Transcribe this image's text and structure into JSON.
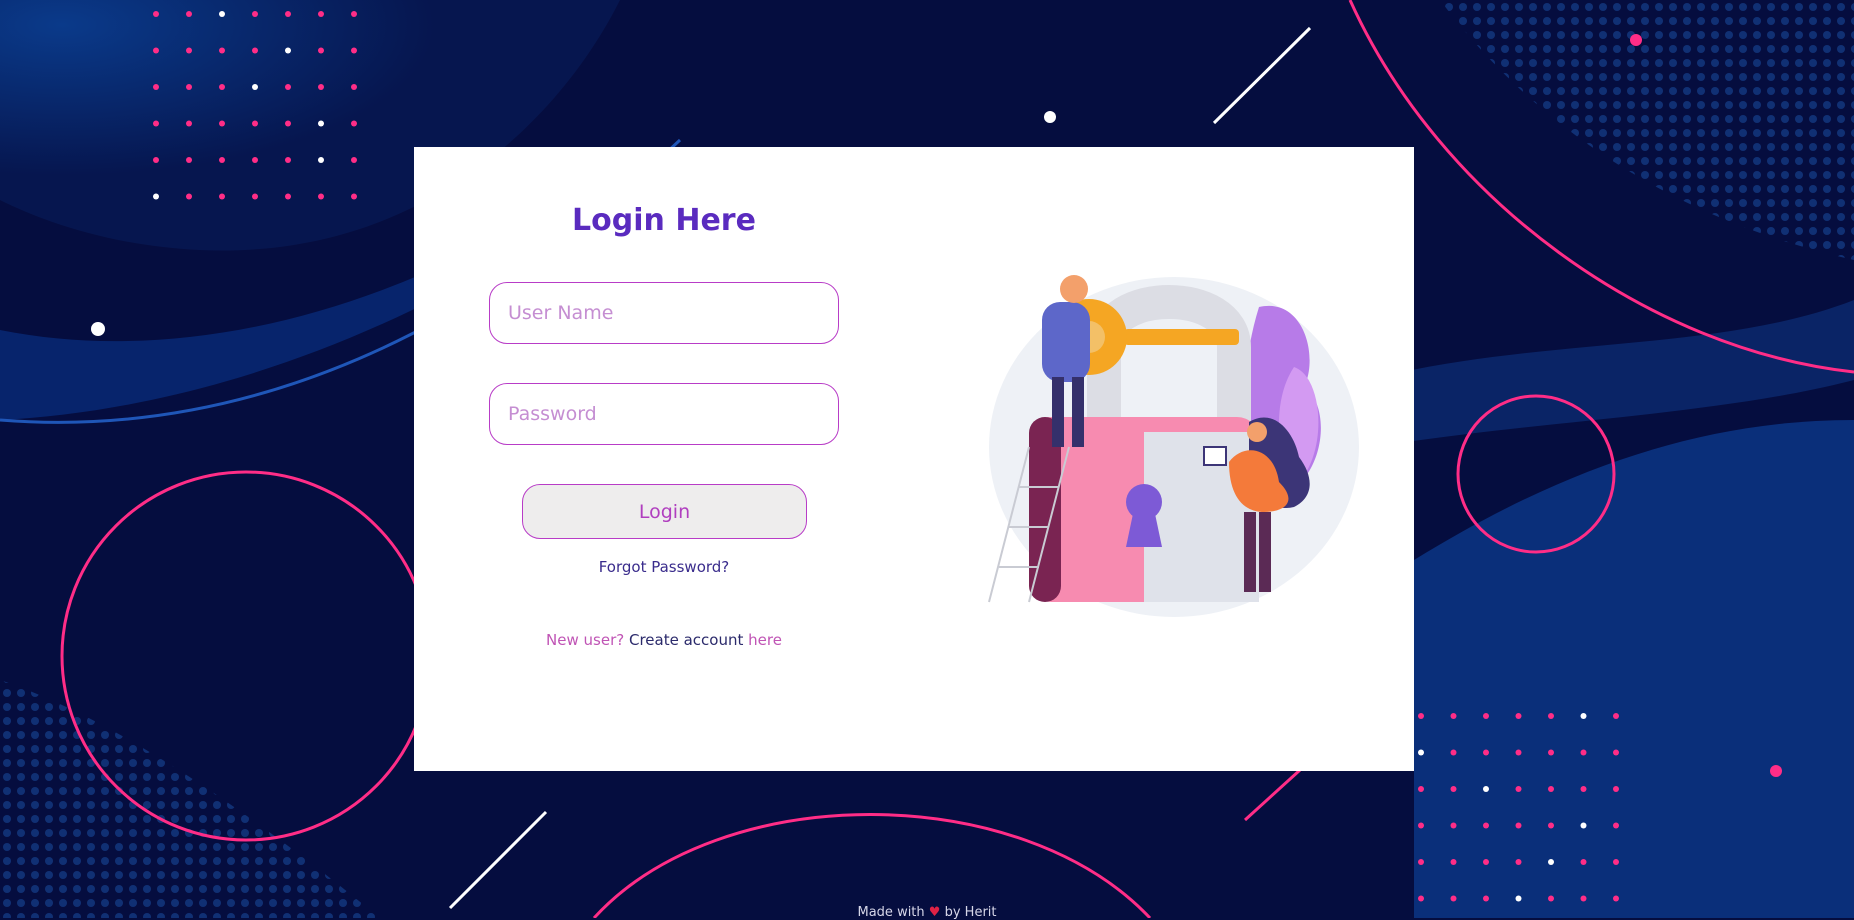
{
  "login": {
    "title": "Login Here",
    "username_placeholder": "User Name",
    "password_placeholder": "Password",
    "login_button": "Login",
    "forgot_password": "Forgot Password?",
    "signup_prefix": "New user?",
    "signup_middle": "Create account",
    "signup_link": "here"
  },
  "footer": {
    "made_with": "Made with",
    "heart": "♥",
    "by": "by Herit"
  },
  "colors": {
    "background": "#050d3f",
    "accent": "#b83cc7",
    "title": "#5a2bbf",
    "decor_pink": "#ff2d87"
  },
  "icons": [
    "padlock-key-illustration",
    "heart-icon"
  ]
}
